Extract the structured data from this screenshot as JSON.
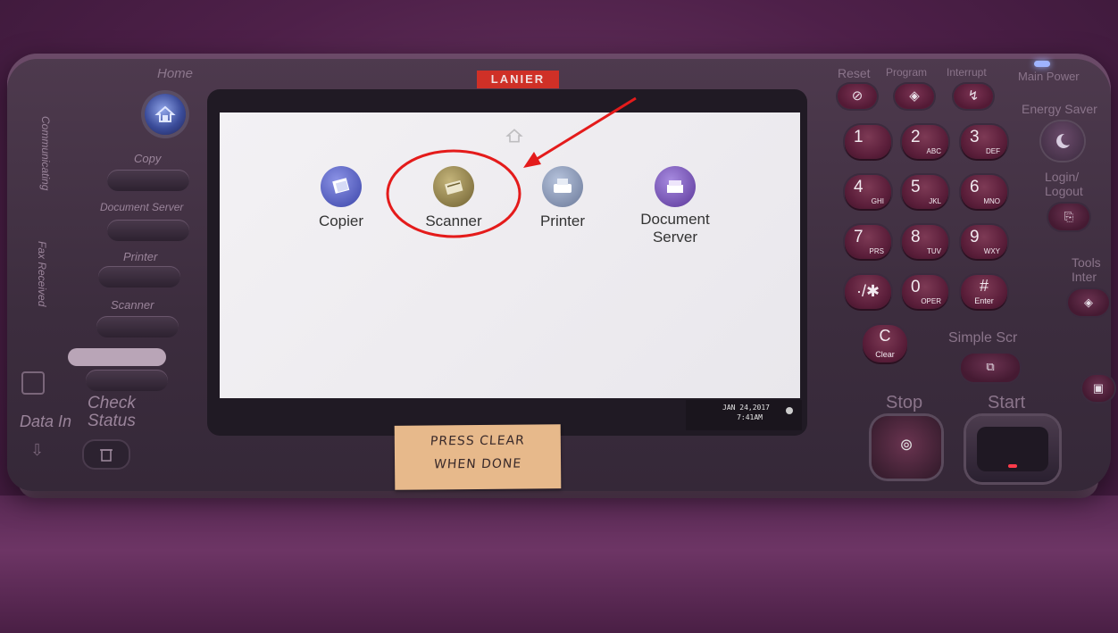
{
  "device": {
    "brand": "LANIER",
    "left_panel": {
      "home_label": "Home",
      "communicating_label": "Communicating",
      "fax_received_label": "Fax Received",
      "copy_label": "Copy",
      "document_server_label": "Document Server",
      "printer_label": "Printer",
      "scanner_label": "Scanner",
      "check_status_label": "Check Status",
      "data_in_label": "Data In"
    },
    "screen": {
      "apps": [
        {
          "label": "Copier",
          "color": "#4a52b8"
        },
        {
          "label": "Scanner",
          "color": "#8a7a3a"
        },
        {
          "label": "Printer",
          "color": "#7a8aa8"
        },
        {
          "label": "Document Server",
          "color": "#6a45a8"
        }
      ],
      "date": "JAN 24,2017",
      "time": "7:41AM"
    },
    "note": {
      "line1": "PRESS CLEAR",
      "line2": "WHEN DONE"
    },
    "right_panel": {
      "reset_label": "Reset",
      "program_label": "Program",
      "interrupt_label": "Interrupt",
      "main_power_label": "Main Power",
      "energy_saver_label": "Energy Saver",
      "login_label": "Login/ Logout",
      "tools_label": "Tools Inter",
      "simple_label": "Simple Scr",
      "stop_label": "Stop",
      "start_label": "Start",
      "clear_label": "Clear",
      "enter_label": "Enter",
      "oper_label": "OPER",
      "keys": [
        {
          "d": "1",
          "s": ""
        },
        {
          "d": "2",
          "s": "ABC"
        },
        {
          "d": "3",
          "s": "DEF"
        },
        {
          "d": "4",
          "s": "GHI"
        },
        {
          "d": "5",
          "s": "JKL"
        },
        {
          "d": "6",
          "s": "MNO"
        },
        {
          "d": "7",
          "s": "PRS"
        },
        {
          "d": "8",
          "s": "TUV"
        },
        {
          "d": "9",
          "s": "WXY"
        }
      ]
    }
  }
}
